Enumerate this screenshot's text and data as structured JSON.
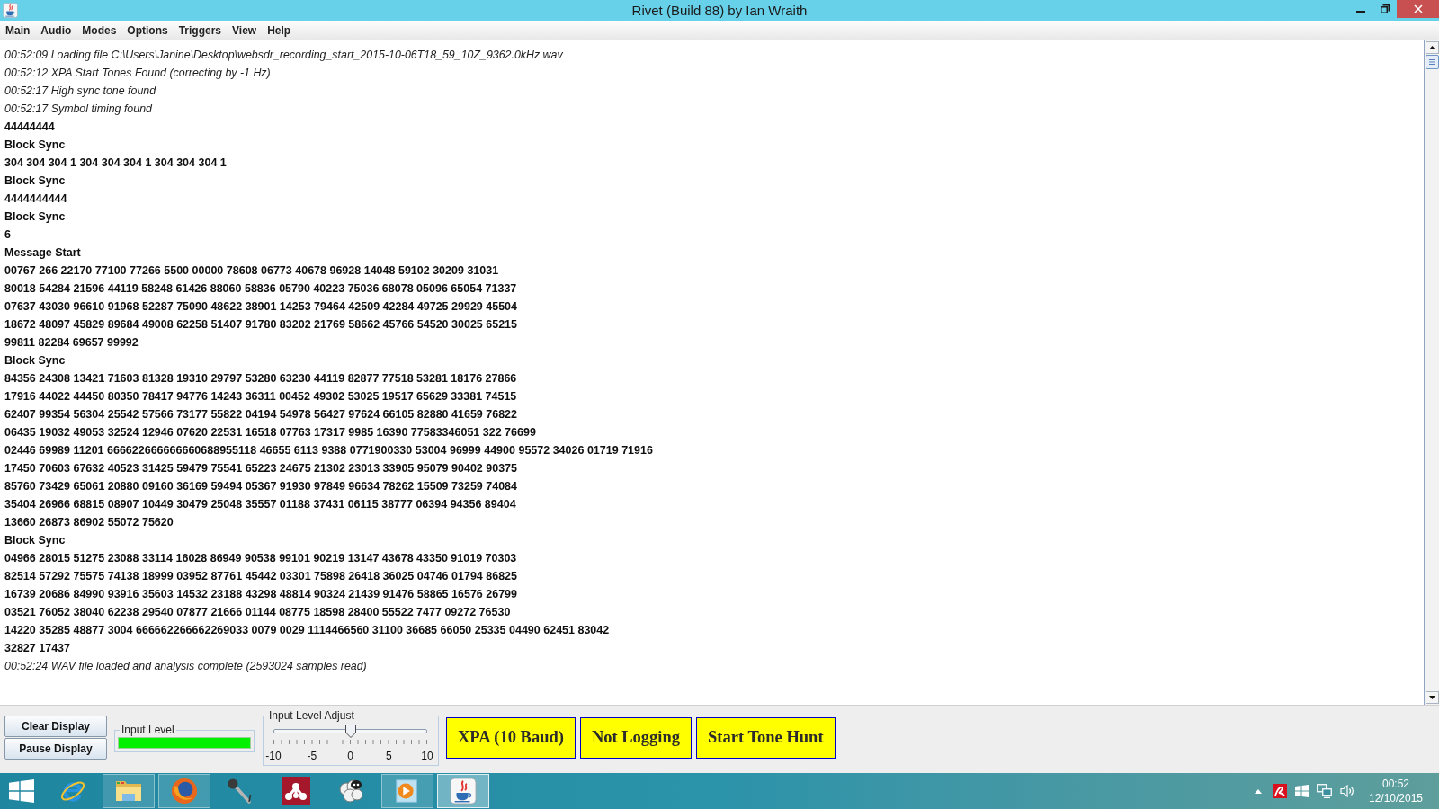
{
  "window": {
    "title": "Rivet (Build 88) by Ian Wraith"
  },
  "menu": [
    "Main",
    "Audio",
    "Modes",
    "Options",
    "Triggers",
    "View",
    "Help"
  ],
  "log": [
    {
      "kind": "status",
      "text": "00:52:09 Loading file C:\\Users\\Janine\\Desktop\\websdr_recording_start_2015-10-06T18_59_10Z_9362.0kHz.wav"
    },
    {
      "kind": "status",
      "text": "00:52:12 XPA Start Tones Found (correcting by -1 Hz)"
    },
    {
      "kind": "status",
      "text": "00:52:17 High sync tone found"
    },
    {
      "kind": "status",
      "text": "00:52:17 Symbol timing found"
    },
    {
      "kind": "decoded",
      "text": "44444444"
    },
    {
      "kind": "decoded",
      "text": "Block Sync"
    },
    {
      "kind": "decoded",
      "text": "304 304 304 1 304 304 304 1 304 304 304 1"
    },
    {
      "kind": "decoded",
      "text": "Block Sync"
    },
    {
      "kind": "decoded",
      "text": "4444444444"
    },
    {
      "kind": "decoded",
      "text": "Block Sync"
    },
    {
      "kind": "decoded",
      "text": "6"
    },
    {
      "kind": "decoded",
      "text": "Message Start"
    },
    {
      "kind": "decoded",
      "text": "00767 266 22170 77100 77266 5500 00000 78608 06773 40678 96928 14048 59102 30209 31031"
    },
    {
      "kind": "decoded",
      "text": "80018 54284 21596 44119 58248 61426 88060 58836 05790 40223 75036 68078 05096 65054 71337"
    },
    {
      "kind": "decoded",
      "text": "07637 43030 96610 91968 52287 75090 48622 38901 14253 79464 42509 42284 49725 29929 45504"
    },
    {
      "kind": "decoded",
      "text": "18672 48097 45829 89684 49008 62258 51407 91780 83202 21769 58662 45766 54520 30025 65215"
    },
    {
      "kind": "decoded",
      "text": "99811 82284 69657 99992"
    },
    {
      "kind": "decoded",
      "text": "Block Sync"
    },
    {
      "kind": "decoded",
      "text": "84356 24308 13421 71603 81328 19310 29797 53280 63230 44119 82877 77518 53281 18176 27866"
    },
    {
      "kind": "decoded",
      "text": "17916 44022 44450 80350 78417 94776 14243 36311 00452 49302 53025 19517 65629 33381 74515"
    },
    {
      "kind": "decoded",
      "text": "62407 99354 56304 25542 57566 73177 55822 04194 54978 56427 97624 66105 82880 41659 76822"
    },
    {
      "kind": "decoded",
      "text": "06435 19032 49053 32524 12946 07620 22531 16518 07763 17317 9985 16390 77583346051 322 76699"
    },
    {
      "kind": "decoded",
      "text": "02446 69989 11201 666622666666660688955118 46655 6113 9388 0771900330 53004 96999 44900 95572 34026 01719 71916"
    },
    {
      "kind": "decoded",
      "text": "17450 70603 67632 40523 31425 59479 75541 65223 24675 21302 23013 33905 95079 90402 90375"
    },
    {
      "kind": "decoded",
      "text": "85760 73429 65061 20880 09160 36169 59494 05367 91930 97849 96634 78262 15509 73259 74084"
    },
    {
      "kind": "decoded",
      "text": "35404 26966 68815 08907 10449 30479 25048 35557 01188 37431 06115 38777 06394 94356 89404"
    },
    {
      "kind": "decoded",
      "text": "13660 26873 86902 55072 75620"
    },
    {
      "kind": "decoded",
      "text": "Block Sync"
    },
    {
      "kind": "decoded",
      "text": "04966 28015 51275 23088 33114 16028 86949 90538 99101 90219 13147 43678 43350 91019 70303"
    },
    {
      "kind": "decoded",
      "text": "82514 57292 75575 74138 18999 03952 87761 45442 03301 75898 26418 36025 04746 01794 86825"
    },
    {
      "kind": "decoded",
      "text": "16739 20686 84990 93916 35603 14532 23188 43298 48814 90324 21439 91476 58865 16576 26799"
    },
    {
      "kind": "decoded",
      "text": "03521 76052 38040 62238 29540 07877 21666 01144 08775 18598 28400 55522 7477 09272 76530"
    },
    {
      "kind": "decoded",
      "text": "14220 35285 48877 3004 666662266662269033 0079 0029 1114466560 31100 36685 66050 25335 04490 62451 83042"
    },
    {
      "kind": "decoded",
      "text": "32827 17437"
    },
    {
      "kind": "status",
      "text": "00:52:24 WAV file loaded and analysis complete (2593024 samples read)"
    }
  ],
  "controls": {
    "display_buttons": [
      "Clear Display",
      "Pause Display"
    ],
    "input_level": {
      "label": "Input Level",
      "level": 1
    },
    "input_level_adjust": {
      "label": "Input Level Adjust",
      "level": 0.5,
      "scale_labels": [
        "-10",
        "-5",
        "0",
        "5",
        "10"
      ]
    },
    "mode_buttons": [
      "XPA (10 Baud)",
      "Not Logging",
      "Start Tone Hunt"
    ]
  },
  "taskbar": {
    "apps": [
      {
        "kind": "e-browser",
        "running": false,
        "active": false
      },
      {
        "kind": "folder",
        "running": true,
        "active": false
      },
      {
        "kind": "fox-browser",
        "running": true,
        "active": false
      },
      {
        "kind": "microphone",
        "running": false,
        "active": false
      },
      {
        "kind": "dots-tile",
        "running": false,
        "active": false
      },
      {
        "kind": "sheep",
        "running": false,
        "active": false
      },
      {
        "kind": "media-player",
        "running": true,
        "active": false
      },
      {
        "kind": "coffee-cup",
        "running": true,
        "active": true
      }
    ],
    "clock": {
      "time": "00:52",
      "date": "12/10/2015"
    }
  }
}
